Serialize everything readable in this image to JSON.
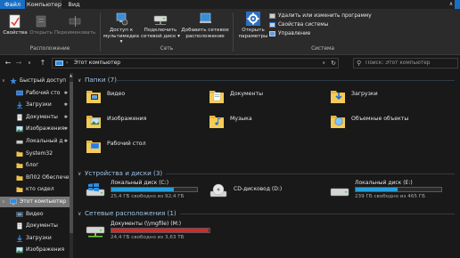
{
  "menu": {
    "file": "Файл",
    "tabs": [
      {
        "label": "Компьютер",
        "active": true
      },
      {
        "label": "Вид",
        "active": false
      }
    ]
  },
  "ribbon": {
    "location": {
      "group_label": "Расположение",
      "buttons": [
        {
          "label": "Свойства",
          "enabled": true,
          "icon": "properties-icon"
        },
        {
          "label": "Открыть",
          "enabled": false,
          "icon": "open-icon"
        },
        {
          "label": "Переименовать",
          "enabled": false,
          "icon": "rename-icon"
        }
      ]
    },
    "network": {
      "group_label": "Сеть",
      "buttons": [
        {
          "label_line1": "Доступ к",
          "label_line2": "мультимедиа ▾",
          "icon": "media-access-icon"
        },
        {
          "label_line1": "Подключить",
          "label_line2": "сетевой диск ▾",
          "icon": "map-drive-icon"
        },
        {
          "label_line1": "Добавить сетевое",
          "label_line2": "расположение",
          "icon": "add-network-location-icon"
        }
      ]
    },
    "system": {
      "group_label": "Система",
      "open_settings": {
        "label_line1": "Открыть",
        "label_line2": "параметры",
        "icon": "settings-gear-icon"
      },
      "small_buttons": [
        {
          "label": "Удалить или изменить программу",
          "icon": "uninstall-icon"
        },
        {
          "label": "Свойства системы",
          "icon": "system-properties-icon"
        },
        {
          "label": "Управление",
          "icon": "manage-icon"
        }
      ]
    }
  },
  "address": {
    "crumb": "Этот компьютер",
    "search_placeholder": "Поиск: Этот компьютер"
  },
  "navpane": {
    "items": [
      {
        "label": "Быстрый доступ",
        "icon": "star-icon",
        "indent": 0,
        "pinned": false,
        "expand": true
      },
      {
        "label": "Рабочий сто",
        "icon": "desktop-icon",
        "indent": 1,
        "pinned": true
      },
      {
        "label": "Загрузки",
        "icon": "downloads-icon",
        "indent": 1,
        "pinned": true
      },
      {
        "label": "Документы",
        "icon": "documents-icon",
        "indent": 1,
        "pinned": true
      },
      {
        "label": "Изображения",
        "icon": "pictures-icon",
        "indent": 1,
        "pinned": true
      },
      {
        "label": "Локальный д",
        "icon": "drive-icon",
        "indent": 1,
        "pinned": true
      },
      {
        "label": "System32",
        "icon": "folder-icon",
        "indent": 1,
        "pinned": false
      },
      {
        "label": "блог",
        "icon": "folder-icon",
        "indent": 1,
        "pinned": false
      },
      {
        "label": "ВП02 Обеспече",
        "icon": "folder-icon",
        "indent": 1,
        "pinned": false
      },
      {
        "label": "кто сидел",
        "icon": "folder-icon",
        "indent": 1,
        "pinned": false
      },
      {
        "label": "Этот компьютер",
        "icon": "computer-icon",
        "indent": 0,
        "pinned": false,
        "selected": true,
        "expand": true
      },
      {
        "label": "Видео",
        "icon": "video-icon",
        "indent": 1,
        "pinned": false
      },
      {
        "label": "Документы",
        "icon": "documents-icon",
        "indent": 1,
        "pinned": false
      },
      {
        "label": "Загрузки",
        "icon": "downloads-icon",
        "indent": 1,
        "pinned": false
      },
      {
        "label": "Изображения",
        "icon": "pictures-icon",
        "indent": 1,
        "pinned": false
      }
    ]
  },
  "content": {
    "folders_header": "Папки (7)",
    "folders": [
      {
        "label": "Видео",
        "icon": "video-folder-icon"
      },
      {
        "label": "Документы",
        "icon": "documents-folder-icon"
      },
      {
        "label": "Загрузки",
        "icon": "downloads-folder-icon"
      },
      {
        "label": "Изображения",
        "icon": "pictures-folder-icon"
      },
      {
        "label": "Музыка",
        "icon": "music-folder-icon"
      },
      {
        "label": "Объемные объекты",
        "icon": "3d-objects-folder-icon"
      },
      {
        "label": "Рабочий стол",
        "icon": "desktop-folder-icon"
      }
    ],
    "drives_header": "Устройства и диски (3)",
    "drives": [
      {
        "name": "Локальный диск (C:)",
        "free": "25,4 ГБ свободно из 92,4 ГБ",
        "used_fraction": 0.725,
        "has_bar": true,
        "bar_color": "#26a0da",
        "icon": "windows-drive-icon"
      },
      {
        "name": "CD-дисковод (D:)",
        "free": "",
        "has_bar": false,
        "icon": "cd-drive-icon"
      },
      {
        "name": "Локальный диск (E:)",
        "free": "239 ГБ свободно из 465 ГБ",
        "used_fraction": 0.486,
        "has_bar": true,
        "bar_color": "#26a0da",
        "icon": "hard-drive-icon"
      }
    ],
    "network_header": "Сетевые расположения (1)",
    "network": [
      {
        "name": "Документы (\\\\mgfile) (M:)",
        "free": "24,4 ГБ свободно из 3,63 ТБ",
        "used_fraction": 0.993,
        "bar_color": "#da2626",
        "icon": "network-drive-icon"
      }
    ]
  }
}
